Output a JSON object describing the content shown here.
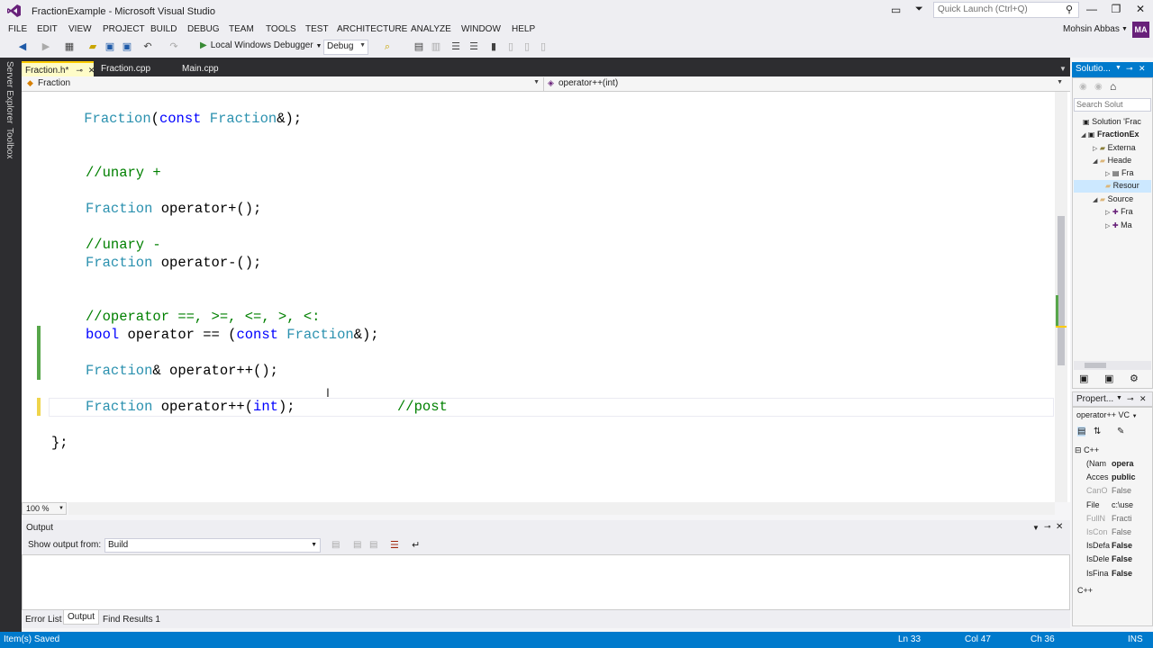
{
  "window": {
    "title": "FractionExample - Microsoft Visual Studio",
    "quick_launch_placeholder": "Quick Launch (Ctrl+Q)",
    "user": "Mohsin Abbas",
    "avatar_initials": "MA"
  },
  "menu": [
    "FILE",
    "EDIT",
    "VIEW",
    "PROJECT",
    "BUILD",
    "DEBUG",
    "TEAM",
    "TOOLS",
    "TEST",
    "ARCHITECTURE",
    "ANALYZE",
    "WINDOW",
    "HELP"
  ],
  "toolbar": {
    "debugger_label": "Local Windows Debugger",
    "config_value": "Debug"
  },
  "left_rail": [
    "Server Explorer",
    "Toolbox"
  ],
  "doc_tabs": [
    "Fraction.h*",
    "Fraction.cpp",
    "Main.cpp"
  ],
  "nav": {
    "class_scope": "Fraction",
    "member_scope": "operator++(int)"
  },
  "code": {
    "l1": [
      "Fraction",
      "(",
      "const",
      " ",
      "Fraction",
      "&);"
    ],
    "c1": "//unary +",
    "l2": [
      "Fraction",
      " operator+();"
    ],
    "c2": "//unary -",
    "l3": [
      "Fraction",
      " operator-();"
    ],
    "c3": "//operator ==, >=, <=, >, <:",
    "l4": [
      "bool",
      " operator == (",
      "const",
      " ",
      "Fraction",
      "&);"
    ],
    "l5": [
      "Fraction",
      "& operator++();"
    ],
    "l6": [
      "Fraction",
      " operator++(",
      "int",
      ");"
    ],
    "l6_comment": "//post",
    "closing": "};"
  },
  "editor": {
    "zoom": "100 %"
  },
  "output": {
    "title": "Output",
    "show_from_label": "Show output from:",
    "source": "Build"
  },
  "bottom_tabs": [
    "Error List",
    "Output",
    "Find Results 1"
  ],
  "solution": {
    "title": "Solutio...",
    "search_placeholder": "Search Solut",
    "items": [
      "Solution 'Frac",
      "FractionEx",
      "Externa",
      "Heade",
      "Fra",
      "Resour",
      "Source",
      "Fra",
      "Ma"
    ]
  },
  "properties": {
    "title": "Propert...",
    "object": "operator++ VC",
    "category": "C++",
    "rows": [
      {
        "name": "(Nam",
        "value": "opera",
        "bold": true,
        "dim": false
      },
      {
        "name": "Acces",
        "value": "public",
        "bold": true,
        "dim": false
      },
      {
        "name": "CanO",
        "value": "False",
        "bold": false,
        "dim": true
      },
      {
        "name": "File",
        "value": "c:\\use",
        "bold": false,
        "dim": false
      },
      {
        "name": "FullN",
        "value": "Fracti",
        "bold": false,
        "dim": true
      },
      {
        "name": "IsCon",
        "value": "False",
        "bold": false,
        "dim": true
      },
      {
        "name": "IsDefa",
        "value": "False",
        "bold": true,
        "dim": false
      },
      {
        "name": "IsDele",
        "value": "False",
        "bold": true,
        "dim": false
      },
      {
        "name": "IsFina",
        "value": "False",
        "bold": true,
        "dim": false
      }
    ],
    "footer": "C++"
  },
  "status": {
    "message": "Item(s) Saved",
    "line": "Ln 33",
    "col": "Col 47",
    "ch": "Ch 36",
    "mode": "INS"
  },
  "colors": {
    "accent": "#007acc",
    "keyword": "#0000ff",
    "type": "#2b91af",
    "comment": "#008000"
  }
}
